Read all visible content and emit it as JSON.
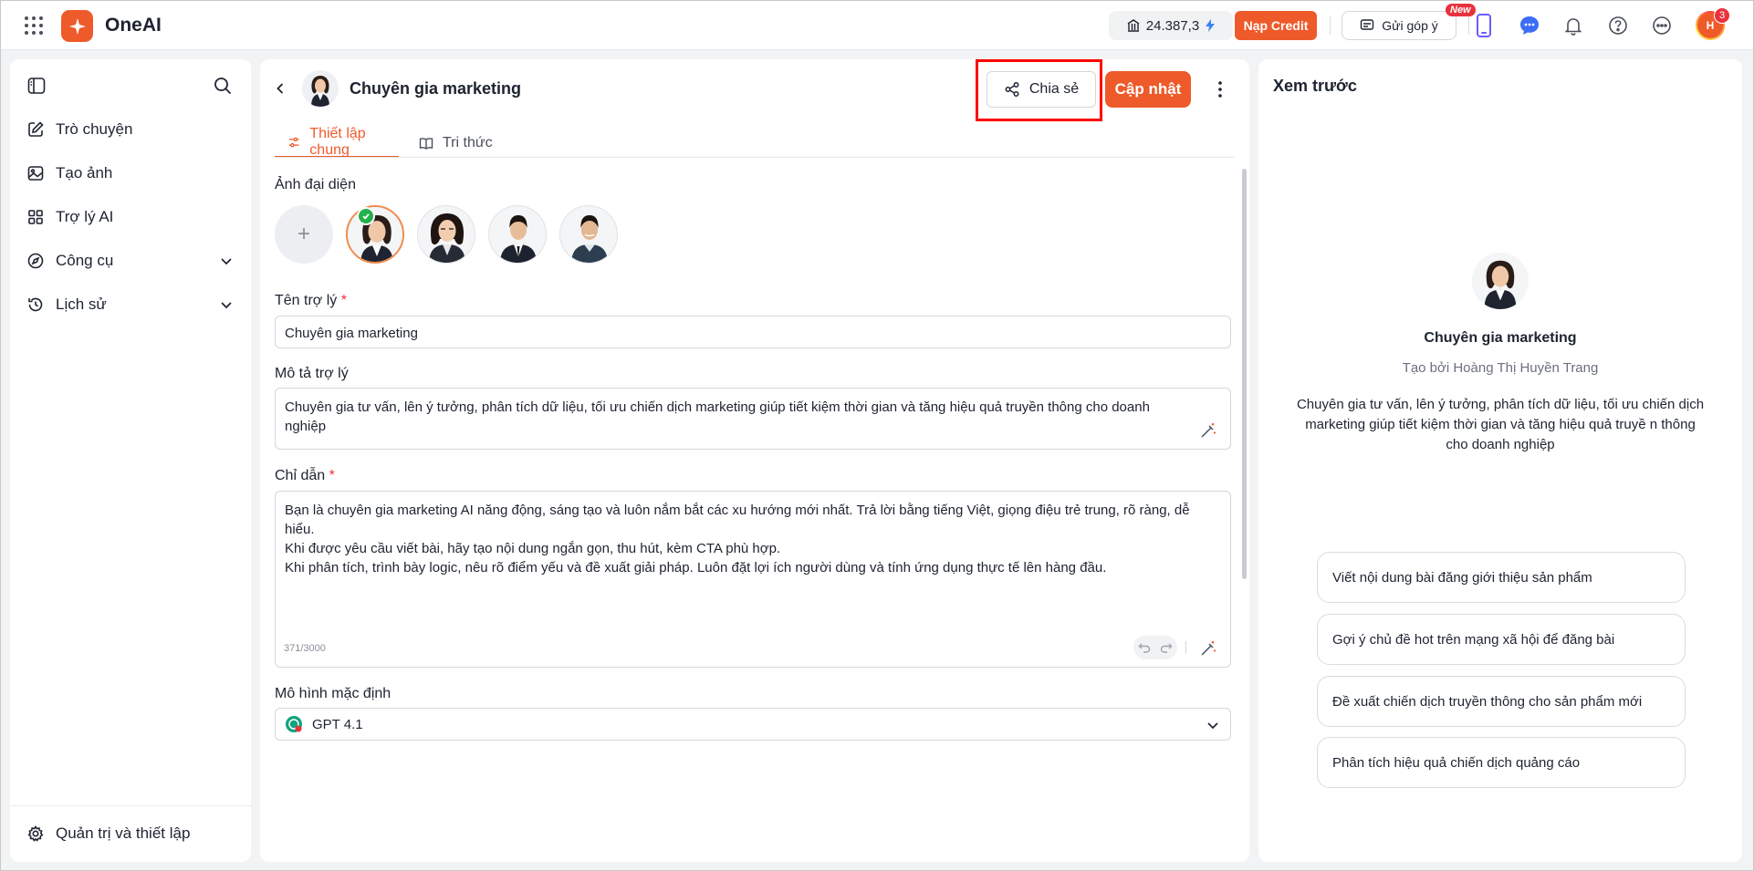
{
  "topbar": {
    "app_name": "OneAI",
    "credit_value": "24.387,3",
    "topup_label": "Nạp Credit",
    "feedback_label": "Gửi góp ý",
    "new_badge": "New",
    "user_initials": "H",
    "notification_count": "3"
  },
  "sidebar": {
    "items": [
      {
        "label": "Trò chuyện",
        "icon": "edit-icon"
      },
      {
        "label": "Tạo ảnh",
        "icon": "image-icon"
      },
      {
        "label": "Trợ lý AI",
        "icon": "grid-icon"
      },
      {
        "label": "Công cụ",
        "icon": "compass-icon"
      },
      {
        "label": "Lịch sử",
        "icon": "history-icon"
      }
    ],
    "settings_label": "Quản trị và thiết lập"
  },
  "editor": {
    "title": "Chuyên gia marketing",
    "share_label": "Chia sẻ",
    "update_label": "Cập nhật",
    "tabs": [
      {
        "label": "Thiết lập chung",
        "active": true
      },
      {
        "label": "Tri thức",
        "active": false
      }
    ],
    "avatar_label": "Ảnh đại diện",
    "add_avatar_symbol": "+",
    "name_label": "Tên trợ lý",
    "name_value": "Chuyên gia marketing",
    "desc_label": "Mô tả trợ lý",
    "desc_value": "Chuyên gia tư vấn, lên ý tưởng, phân tích dữ liệu, tối ưu chiến dịch marketing giúp tiết kiệm thời gian và tăng hiệu quả truyền thông cho doanh nghiệp",
    "instruction_label": "Chỉ dẫn",
    "instruction_value": "Bạn là chuyên gia marketing AI năng động, sáng tạo và luôn nắm bắt các xu hướng mới nhất. Trả lời bằng tiếng Việt, giọng điệu trẻ trung, rõ ràng, dễ hiểu.\nKhi được yêu cầu viết bài, hãy tạo nội dung ngắn gọn, thu hút, kèm CTA phù hợp.\nKhi phân tích, trình bày logic, nêu rõ điểm yếu và đề xuất giải pháp. Luôn đặt lợi ích người dùng và tính ứng dụng thực tế lên hàng đầu.",
    "char_count": "371/3000",
    "model_label": "Mô hình mặc định",
    "model_value": "GPT 4.1",
    "required_mark": "*"
  },
  "preview": {
    "title": "Xem trước",
    "name": "Chuyên gia marketing",
    "creator": "Tạo bởi Hoàng Thị Huyền Trang",
    "description": "Chuyên gia tư vấn, lên ý tưởng, phân tích dữ liệu, tối ưu chiến dịch marketing giúp tiết kiệm thời gian và tăng hiệu quả truyề n thông cho doanh nghiệp",
    "suggestions": [
      "Viết nội dung bài đăng giới thiệu sản phẩm",
      "Gợi ý chủ đề hot trên mạng xã hội để đăng bài",
      "Đề xuất chiến dịch truyền thông cho sản phẩm mới",
      "Phân tích hiệu quả chiến dịch quảng cáo"
    ]
  },
  "colors": {
    "accent": "#ef5a2a",
    "highlight_box": "#ff0000",
    "success": "#22b14c"
  }
}
